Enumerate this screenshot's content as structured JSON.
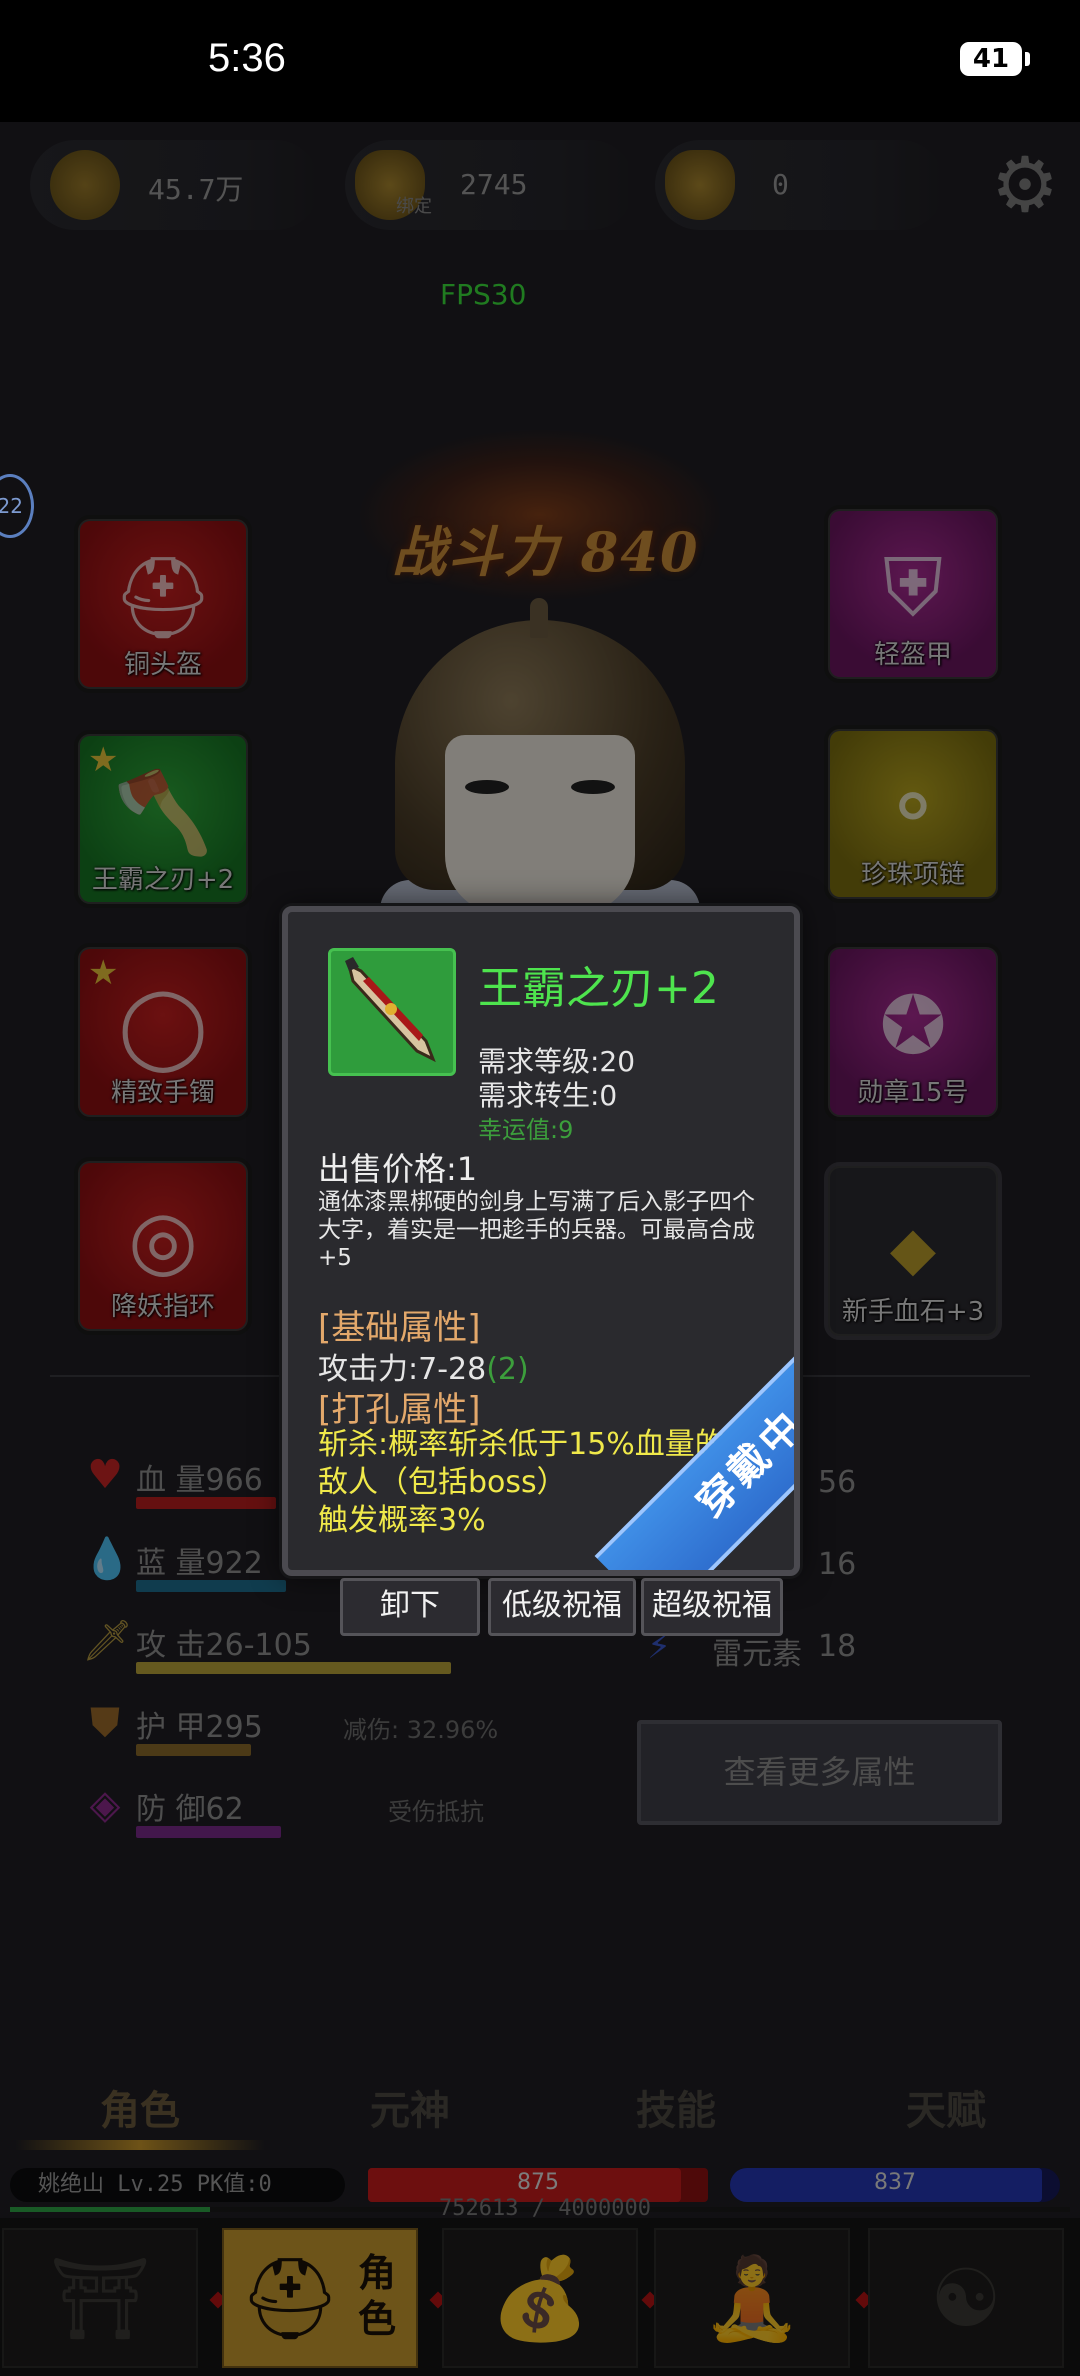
{
  "status_bar": {
    "time": "5:36",
    "battery": "41"
  },
  "currency": {
    "copper": "45.7万",
    "bound_label": "绑定",
    "bound_ingot": "2745",
    "gold_ingot": "0"
  },
  "fps": "FPS30",
  "side_badge": "22",
  "combat_power": "战斗力 840",
  "slots": {
    "helmet": "铜头盔",
    "weapon": "王霸之刃+2",
    "bracelet": "精致手镯",
    "ring": "降妖指环",
    "armor": "轻盔甲",
    "necklace": "珍珠项链",
    "medal": "勋章15号",
    "gem": "新手血石+3",
    "star": "★"
  },
  "stats": {
    "hp": "血 量966",
    "mp": "蓝 量922",
    "attack": "攻 击26-105",
    "armor": "护 甲295",
    "armor_note": "减伤: 32.96%",
    "defense": "防 御62",
    "defense_note": "受伤抵抗",
    "right1": "56",
    "right2": "16",
    "right3_label": "雷元素",
    "right3": "18",
    "more_button": "查看更多属性"
  },
  "tooltip": {
    "name": "王霸之刃+2",
    "req_level": "需求等级:20",
    "req_rebirth": "需求转生:0",
    "luck": "幸运值:9",
    "price": "出售价格:1",
    "description": "通体漆黑梆硬的剑身上写满了后入影子四个大字，着实是一把趁手的兵器。可最高合成+5",
    "base_header": "[基础属性]",
    "attack": "攻击力:7-28",
    "attack_bonus": "(2)",
    "socket_header": "[打孔属性]",
    "skill_line1": "斩杀:概率斩杀低于15%血量的",
    "skill_line2": "敌人（包括boss）",
    "skill_line3": "触发概率3%",
    "equipped_ribbon": "穿戴中",
    "btn_unequip": "卸下",
    "btn_low_bless": "低级祝福",
    "btn_super_bless": "超级祝福"
  },
  "tabs": [
    "角色",
    "元神",
    "技能",
    "天赋"
  ],
  "player": {
    "info": "姚绝山  Lv.25 PK值:0",
    "hp": "875",
    "mp": "837",
    "exp": "752613 / 4000000"
  },
  "nav": {
    "active_label": "角色"
  },
  "colors": {
    "hp": "#c71d1d",
    "mp": "#2537b4",
    "exp": "#2fa446",
    "item_name": "#4ee44e",
    "skill_text": "#f0e94a",
    "nav_active": "#c69a2e"
  }
}
